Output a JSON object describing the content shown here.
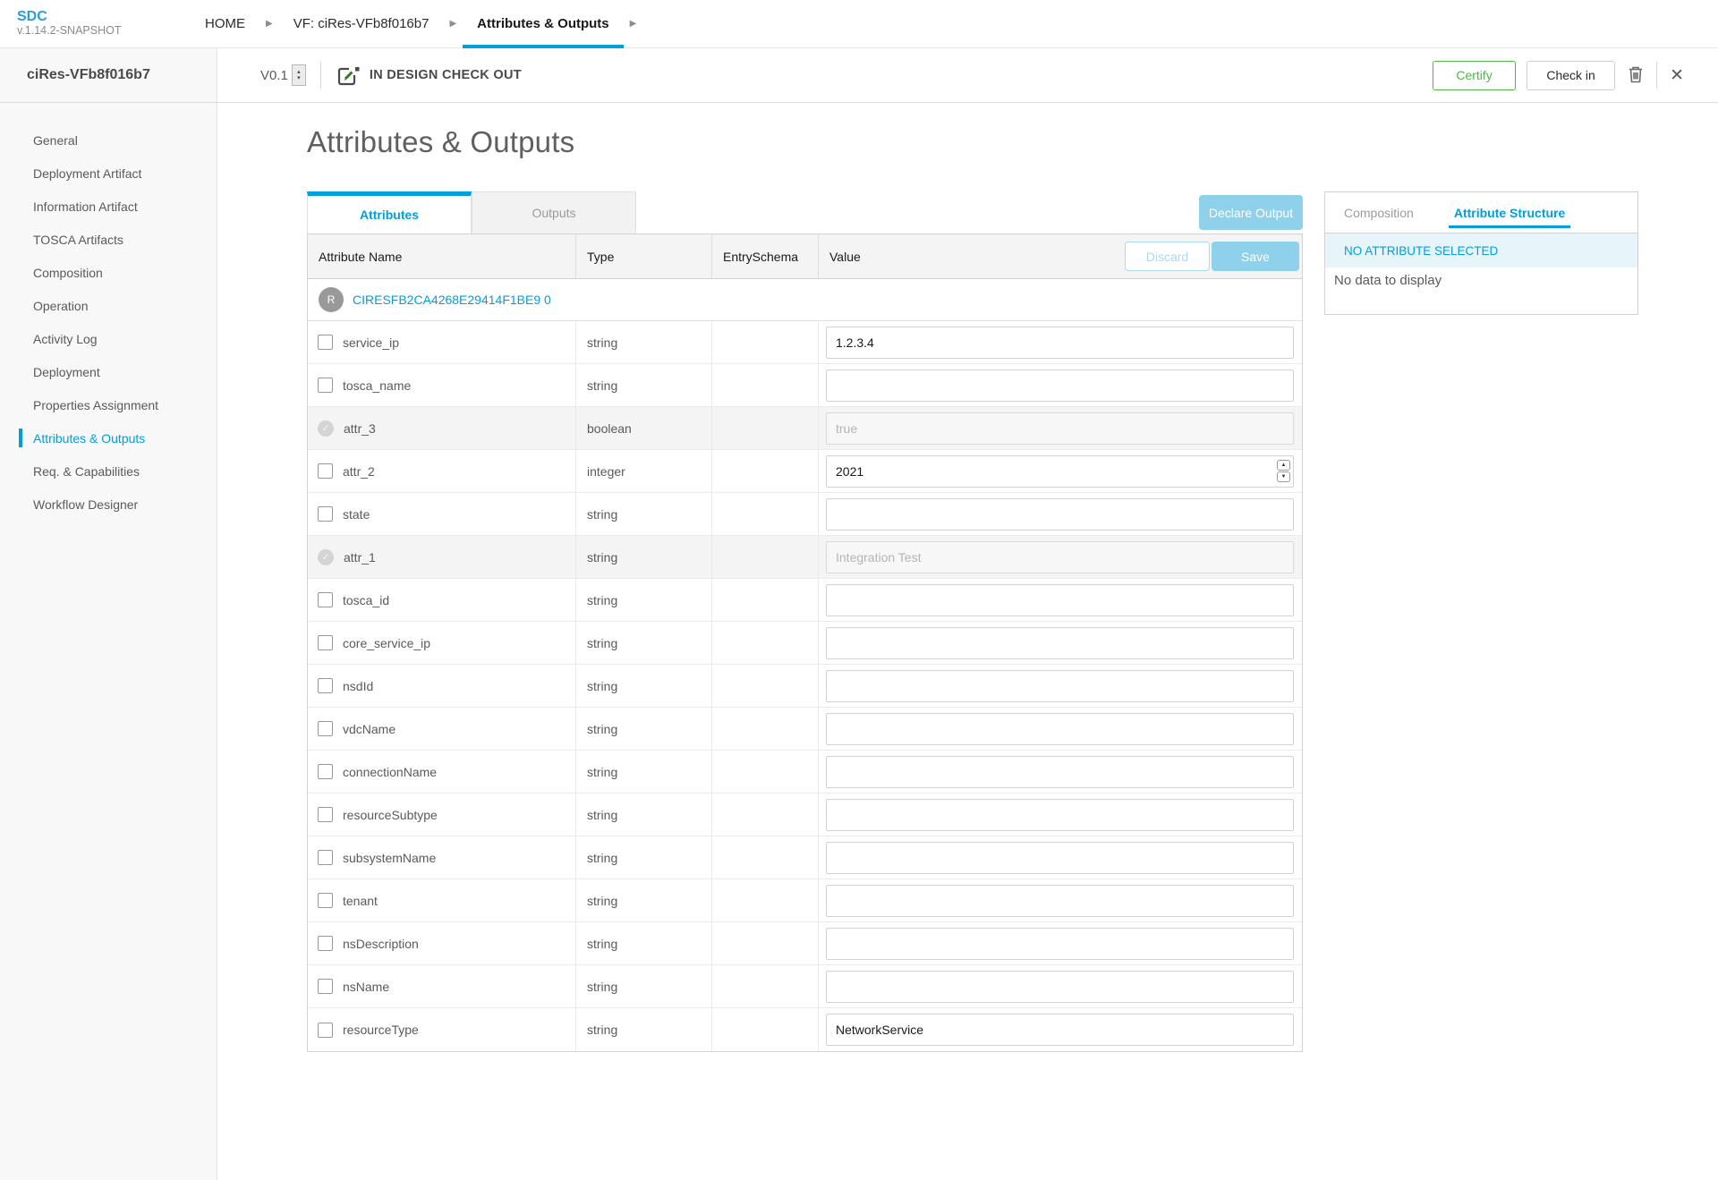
{
  "topbar": {
    "logo": {
      "title": "SDC",
      "version": "v.1.14.2-SNAPSHOT"
    },
    "breadcrumbs": [
      {
        "label": "HOME",
        "active": false
      },
      {
        "label": "VF: ciRes-VFb8f016b7",
        "active": false
      },
      {
        "label": "Attributes & Outputs",
        "active": true
      }
    ]
  },
  "sidebar": {
    "title": "ciRes-VFb8f016b7",
    "items": [
      {
        "label": "General",
        "active": false
      },
      {
        "label": "Deployment Artifact",
        "active": false
      },
      {
        "label": "Information Artifact",
        "active": false
      },
      {
        "label": "TOSCA Artifacts",
        "active": false
      },
      {
        "label": "Composition",
        "active": false
      },
      {
        "label": "Operation",
        "active": false
      },
      {
        "label": "Activity Log",
        "active": false
      },
      {
        "label": "Deployment",
        "active": false
      },
      {
        "label": "Properties Assignment",
        "active": false
      },
      {
        "label": "Attributes & Outputs",
        "active": true
      },
      {
        "label": "Req. & Capabilities",
        "active": false
      },
      {
        "label": "Workflow Designer",
        "active": false
      }
    ]
  },
  "toolbar": {
    "version": "V0.1",
    "status": "IN DESIGN CHECK OUT",
    "certify_label": "Certify",
    "checkin_label": "Check in"
  },
  "page": {
    "title": "Attributes & Outputs"
  },
  "tabs": [
    {
      "label": "Attributes",
      "active": true
    },
    {
      "label": "Outputs",
      "active": false
    }
  ],
  "actions": {
    "declare_output": "Declare Output",
    "discard": "Discard",
    "save": "Save"
  },
  "table": {
    "columns": [
      "Attribute Name",
      "Type",
      "EntrySchema",
      "Value"
    ],
    "resource_group": {
      "avatar": "R",
      "name": "CIRESFB2CA4268E29414F1BE9 0"
    },
    "rows": [
      {
        "name": "service_ip",
        "type": "string",
        "entry_schema": "",
        "value": "1.2.3.4",
        "disabled": false,
        "input_kind": "text"
      },
      {
        "name": "tosca_name",
        "type": "string",
        "entry_schema": "",
        "value": "",
        "disabled": false,
        "input_kind": "text"
      },
      {
        "name": "attr_3",
        "type": "boolean",
        "entry_schema": "",
        "value": "true",
        "disabled": true,
        "input_kind": "text"
      },
      {
        "name": "attr_2",
        "type": "integer",
        "entry_schema": "",
        "value": "2021",
        "disabled": false,
        "input_kind": "number"
      },
      {
        "name": "state",
        "type": "string",
        "entry_schema": "",
        "value": "",
        "disabled": false,
        "input_kind": "text"
      },
      {
        "name": "attr_1",
        "type": "string",
        "entry_schema": "",
        "value": "Integration Test",
        "disabled": true,
        "input_kind": "text"
      },
      {
        "name": "tosca_id",
        "type": "string",
        "entry_schema": "",
        "value": "",
        "disabled": false,
        "input_kind": "text"
      },
      {
        "name": "core_service_ip",
        "type": "string",
        "entry_schema": "",
        "value": "",
        "disabled": false,
        "input_kind": "text"
      },
      {
        "name": "nsdId",
        "type": "string",
        "entry_schema": "",
        "value": "",
        "disabled": false,
        "input_kind": "text"
      },
      {
        "name": "vdcName",
        "type": "string",
        "entry_schema": "",
        "value": "",
        "disabled": false,
        "input_kind": "text"
      },
      {
        "name": "connectionName",
        "type": "string",
        "entry_schema": "",
        "value": "",
        "disabled": false,
        "input_kind": "text"
      },
      {
        "name": "resourceSubtype",
        "type": "string",
        "entry_schema": "",
        "value": "",
        "disabled": false,
        "input_kind": "text"
      },
      {
        "name": "subsystemName",
        "type": "string",
        "entry_schema": "",
        "value": "",
        "disabled": false,
        "input_kind": "text"
      },
      {
        "name": "tenant",
        "type": "string",
        "entry_schema": "",
        "value": "",
        "disabled": false,
        "input_kind": "text"
      },
      {
        "name": "nsDescription",
        "type": "string",
        "entry_schema": "",
        "value": "",
        "disabled": false,
        "input_kind": "text"
      },
      {
        "name": "nsName",
        "type": "string",
        "entry_schema": "",
        "value": "",
        "disabled": false,
        "input_kind": "text"
      },
      {
        "name": "resourceType",
        "type": "string",
        "entry_schema": "",
        "value": "NetworkService",
        "disabled": false,
        "input_kind": "text"
      }
    ]
  },
  "right_panel": {
    "tabs": [
      {
        "label": "Composition",
        "active": false
      },
      {
        "label": "Attribute Structure",
        "active": true
      }
    ],
    "banner": "NO ATTRIBUTE SELECTED",
    "empty_message": "No data to display"
  },
  "colors": {
    "accent_blue": "#009fdb",
    "light_blue_button": "#8fd0ea",
    "certify_green": "#52b646",
    "sidebar_bg": "#f8f8f8",
    "banner_bg": "#e7f5fb"
  }
}
